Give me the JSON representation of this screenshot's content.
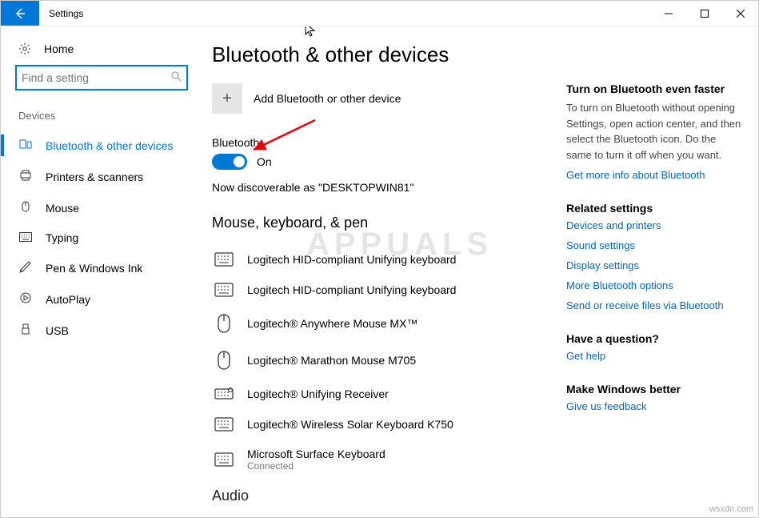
{
  "window": {
    "title": "Settings"
  },
  "sidebar": {
    "home": "Home",
    "search_placeholder": "Find a setting",
    "category": "Devices",
    "items": [
      {
        "label": "Bluetooth & other devices",
        "icon": "⟳",
        "active": true
      },
      {
        "label": "Printers & scanners",
        "icon": "🖶",
        "active": false
      },
      {
        "label": "Mouse",
        "icon": "🖱",
        "active": false
      },
      {
        "label": "Typing",
        "icon": "⌨",
        "active": false
      },
      {
        "label": "Pen & Windows Ink",
        "icon": "✎",
        "active": false
      },
      {
        "label": "AutoPlay",
        "icon": "▷",
        "active": false
      },
      {
        "label": "USB",
        "icon": "🖯",
        "active": false
      }
    ]
  },
  "main": {
    "title": "Bluetooth & other devices",
    "add_label": "Add Bluetooth or other device",
    "bt_label": "Bluetooth",
    "bt_state": "On",
    "discoverable": "Now discoverable as \"DESKTOPWIN81\"",
    "sub_heading": "Mouse, keyboard, & pen",
    "devices": [
      {
        "name": "Logitech HID-compliant Unifying keyboard",
        "type": "keyboard",
        "status": ""
      },
      {
        "name": "Logitech HID-compliant Unifying keyboard",
        "type": "keyboard",
        "status": ""
      },
      {
        "name": "Logitech® Anywhere Mouse MX™",
        "type": "mouse",
        "status": ""
      },
      {
        "name": "Logitech® Marathon Mouse M705",
        "type": "mouse",
        "status": ""
      },
      {
        "name": "Logitech® Unifying Receiver",
        "type": "receiver",
        "status": ""
      },
      {
        "name": "Logitech® Wireless Solar Keyboard K750",
        "type": "keyboard",
        "status": ""
      },
      {
        "name": "Microsoft Surface Keyboard",
        "type": "keyboard",
        "status": "Connected"
      }
    ],
    "next_heading": "Audio"
  },
  "right": {
    "tip_heading": "Turn on Bluetooth even faster",
    "tip_text": "To turn on Bluetooth without opening Settings, open action center, and then select the Bluetooth icon. Do the same to turn it off when you want.",
    "tip_link": "Get more info about Bluetooth",
    "related_heading": "Related settings",
    "related_links": [
      "Devices and printers",
      "Sound settings",
      "Display settings",
      "More Bluetooth options",
      "Send or receive files via Bluetooth"
    ],
    "question_heading": "Have a question?",
    "help_link": "Get help",
    "feedback_heading": "Make Windows better",
    "feedback_link": "Give us feedback"
  },
  "watermark": "APPUALS",
  "source": "wsxdn.com"
}
